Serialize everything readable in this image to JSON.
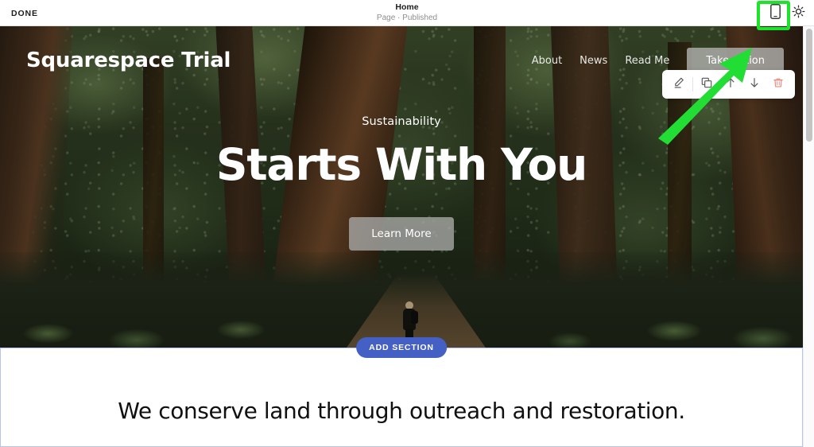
{
  "editor": {
    "done_label": "DONE",
    "page_title": "Home",
    "page_status": "Page · Published",
    "mobile_icon": "mobile-device-icon",
    "settings_icon": "gear-icon",
    "highlight_color": "#1EE32B",
    "annotation_arrow_color": "#22DD33"
  },
  "site": {
    "title": "Squarespace Trial",
    "nav": [
      {
        "label": "About"
      },
      {
        "label": "News"
      },
      {
        "label": "Read Me"
      }
    ],
    "cta_label": "Take Action",
    "hero": {
      "eyebrow": "Sustainability",
      "headline": "Starts With You",
      "button_label": "Learn More"
    }
  },
  "add_section": {
    "label": "ADD SECTION",
    "color": "#4560c4"
  },
  "section_two": {
    "heading": "We conserve land through outreach and restoration.",
    "highlight_border": "#b9c3ef",
    "toolbar": [
      {
        "icon": "pencil-edit-icon",
        "name": "edit"
      },
      {
        "icon": "duplicate-icon",
        "name": "duplicate"
      },
      {
        "icon": "arrow-up-icon",
        "name": "move-up"
      },
      {
        "icon": "arrow-down-icon",
        "name": "move-down"
      },
      {
        "icon": "trash-delete-icon",
        "name": "delete",
        "color": "#e8897f"
      }
    ]
  }
}
